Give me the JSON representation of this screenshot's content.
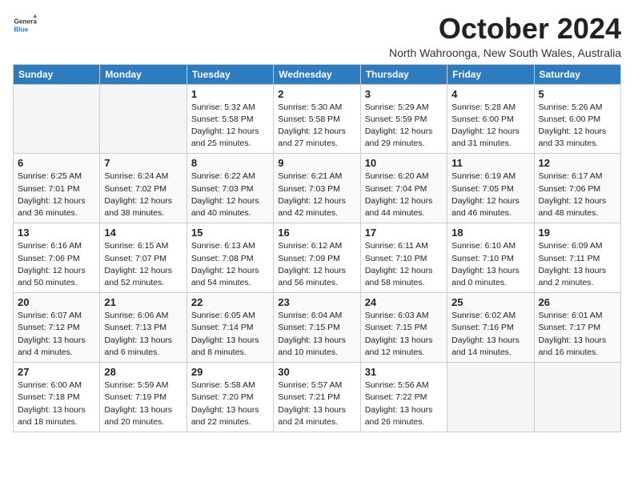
{
  "logo": {
    "line1": "General",
    "line2": "Blue"
  },
  "title": "October 2024",
  "subtitle": "North Wahroonga, New South Wales, Australia",
  "headers": [
    "Sunday",
    "Monday",
    "Tuesday",
    "Wednesday",
    "Thursday",
    "Friday",
    "Saturday"
  ],
  "weeks": [
    [
      {
        "day": "",
        "info": ""
      },
      {
        "day": "",
        "info": ""
      },
      {
        "day": "1",
        "info": "Sunrise: 5:32 AM\nSunset: 5:58 PM\nDaylight: 12 hours\nand 25 minutes."
      },
      {
        "day": "2",
        "info": "Sunrise: 5:30 AM\nSunset: 5:58 PM\nDaylight: 12 hours\nand 27 minutes."
      },
      {
        "day": "3",
        "info": "Sunrise: 5:29 AM\nSunset: 5:59 PM\nDaylight: 12 hours\nand 29 minutes."
      },
      {
        "day": "4",
        "info": "Sunrise: 5:28 AM\nSunset: 6:00 PM\nDaylight: 12 hours\nand 31 minutes."
      },
      {
        "day": "5",
        "info": "Sunrise: 5:26 AM\nSunset: 6:00 PM\nDaylight: 12 hours\nand 33 minutes."
      }
    ],
    [
      {
        "day": "6",
        "info": "Sunrise: 6:25 AM\nSunset: 7:01 PM\nDaylight: 12 hours\nand 36 minutes."
      },
      {
        "day": "7",
        "info": "Sunrise: 6:24 AM\nSunset: 7:02 PM\nDaylight: 12 hours\nand 38 minutes."
      },
      {
        "day": "8",
        "info": "Sunrise: 6:22 AM\nSunset: 7:03 PM\nDaylight: 12 hours\nand 40 minutes."
      },
      {
        "day": "9",
        "info": "Sunrise: 6:21 AM\nSunset: 7:03 PM\nDaylight: 12 hours\nand 42 minutes."
      },
      {
        "day": "10",
        "info": "Sunrise: 6:20 AM\nSunset: 7:04 PM\nDaylight: 12 hours\nand 44 minutes."
      },
      {
        "day": "11",
        "info": "Sunrise: 6:19 AM\nSunset: 7:05 PM\nDaylight: 12 hours\nand 46 minutes."
      },
      {
        "day": "12",
        "info": "Sunrise: 6:17 AM\nSunset: 7:06 PM\nDaylight: 12 hours\nand 48 minutes."
      }
    ],
    [
      {
        "day": "13",
        "info": "Sunrise: 6:16 AM\nSunset: 7:06 PM\nDaylight: 12 hours\nand 50 minutes."
      },
      {
        "day": "14",
        "info": "Sunrise: 6:15 AM\nSunset: 7:07 PM\nDaylight: 12 hours\nand 52 minutes."
      },
      {
        "day": "15",
        "info": "Sunrise: 6:13 AM\nSunset: 7:08 PM\nDaylight: 12 hours\nand 54 minutes."
      },
      {
        "day": "16",
        "info": "Sunrise: 6:12 AM\nSunset: 7:09 PM\nDaylight: 12 hours\nand 56 minutes."
      },
      {
        "day": "17",
        "info": "Sunrise: 6:11 AM\nSunset: 7:10 PM\nDaylight: 12 hours\nand 58 minutes."
      },
      {
        "day": "18",
        "info": "Sunrise: 6:10 AM\nSunset: 7:10 PM\nDaylight: 13 hours\nand 0 minutes."
      },
      {
        "day": "19",
        "info": "Sunrise: 6:09 AM\nSunset: 7:11 PM\nDaylight: 13 hours\nand 2 minutes."
      }
    ],
    [
      {
        "day": "20",
        "info": "Sunrise: 6:07 AM\nSunset: 7:12 PM\nDaylight: 13 hours\nand 4 minutes."
      },
      {
        "day": "21",
        "info": "Sunrise: 6:06 AM\nSunset: 7:13 PM\nDaylight: 13 hours\nand 6 minutes."
      },
      {
        "day": "22",
        "info": "Sunrise: 6:05 AM\nSunset: 7:14 PM\nDaylight: 13 hours\nand 8 minutes."
      },
      {
        "day": "23",
        "info": "Sunrise: 6:04 AM\nSunset: 7:15 PM\nDaylight: 13 hours\nand 10 minutes."
      },
      {
        "day": "24",
        "info": "Sunrise: 6:03 AM\nSunset: 7:15 PM\nDaylight: 13 hours\nand 12 minutes."
      },
      {
        "day": "25",
        "info": "Sunrise: 6:02 AM\nSunset: 7:16 PM\nDaylight: 13 hours\nand 14 minutes."
      },
      {
        "day": "26",
        "info": "Sunrise: 6:01 AM\nSunset: 7:17 PM\nDaylight: 13 hours\nand 16 minutes."
      }
    ],
    [
      {
        "day": "27",
        "info": "Sunrise: 6:00 AM\nSunset: 7:18 PM\nDaylight: 13 hours\nand 18 minutes."
      },
      {
        "day": "28",
        "info": "Sunrise: 5:59 AM\nSunset: 7:19 PM\nDaylight: 13 hours\nand 20 minutes."
      },
      {
        "day": "29",
        "info": "Sunrise: 5:58 AM\nSunset: 7:20 PM\nDaylight: 13 hours\nand 22 minutes."
      },
      {
        "day": "30",
        "info": "Sunrise: 5:57 AM\nSunset: 7:21 PM\nDaylight: 13 hours\nand 24 minutes."
      },
      {
        "day": "31",
        "info": "Sunrise: 5:56 AM\nSunset: 7:22 PM\nDaylight: 13 hours\nand 26 minutes."
      },
      {
        "day": "",
        "info": ""
      },
      {
        "day": "",
        "info": ""
      }
    ]
  ]
}
